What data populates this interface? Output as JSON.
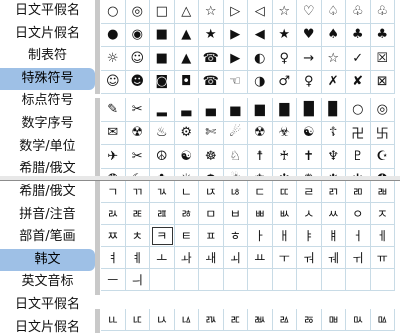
{
  "top_panel": {
    "sidebar": [
      {
        "label": "日文平假名",
        "active": false
      },
      {
        "label": "日文片假名",
        "active": false
      },
      {
        "label": "制表符",
        "active": false
      },
      {
        "label": "特殊符号",
        "active": true
      },
      {
        "label": "标点符号",
        "active": false
      },
      {
        "label": "数字序号",
        "active": false
      },
      {
        "label": "数学/单位",
        "active": false
      },
      {
        "label": "希腊/俄文",
        "active": false
      }
    ],
    "block1": [
      [
        "○",
        "◎",
        "□",
        "△",
        "☆",
        "▷",
        "◁",
        "☆",
        "♡",
        "♤",
        "♧",
        "♧"
      ],
      [
        "●",
        "◉",
        "■",
        "▲",
        "★",
        "▶",
        "◀",
        "★",
        "♥",
        "♠",
        "♣",
        "♣"
      ],
      [
        "☼",
        "☺",
        "■",
        "▲",
        "☎",
        "▶",
        "◐",
        "♀",
        "→",
        "☆",
        "✓",
        "☒"
      ],
      [
        "☺",
        "☻",
        "◙",
        "◘",
        "☎",
        "☜",
        "◑",
        "♂",
        "♀",
        "✗",
        "✘",
        "⊠"
      ]
    ],
    "block2": [
      [
        "✎",
        "✂",
        "▂",
        "▃",
        "▄",
        "▅",
        "▆",
        "▇",
        "█",
        "▉",
        "○",
        "◎"
      ],
      [
        "✉",
        "☢",
        "♨",
        "⚙",
        "✄",
        "☄",
        "☢",
        "☣",
        "☯",
        "☦",
        "卍",
        "卐"
      ],
      [
        "✈",
        "✂",
        "☮",
        "☯",
        "☸",
        "♘",
        "☨",
        "♰",
        "✝",
        "♆",
        "♇",
        "☪"
      ],
      [
        "❂",
        "☾",
        "✿",
        "☀",
        "☂",
        "☃",
        "❄",
        "✼",
        "✺",
        "❉",
        "✲",
        "✪"
      ]
    ]
  },
  "bottom_panel": {
    "sidebar": [
      {
        "label": "希腊/俄文",
        "active": false
      },
      {
        "label": "拼音/注音",
        "active": false
      },
      {
        "label": "部首/笔画",
        "active": false
      },
      {
        "label": "韩文",
        "active": true
      },
      {
        "label": "英文音标",
        "active": false
      },
      {
        "label": "日文平假名",
        "active": false
      },
      {
        "label": "日文片假名",
        "active": false
      }
    ],
    "block1": [
      [
        "ㄱ",
        "ㄲ",
        "ㄳ",
        "ㄴ",
        "ㄵ",
        "ㄶ",
        "ㄷ",
        "ㄸ",
        "ㄹ",
        "ㄺ",
        "ㄻ",
        "ㄼ"
      ],
      [
        "ㄽ",
        "ㄾ",
        "ㄿ",
        "ㅀ",
        "ㅁ",
        "ㅂ",
        "ㅃ",
        "ㅄ",
        "ㅅ",
        "ㅆ",
        "ㅇ",
        "ㅈ"
      ],
      [
        "ㅉ",
        "ㅊ",
        "ㅋ",
        "ㅌ",
        "ㅍ",
        "ㅎ",
        "ㅏ",
        "ㅐ",
        "ㅑ",
        "ㅒ",
        "ㅓ",
        "ㅔ"
      ],
      [
        "ㅕ",
        "ㅖ",
        "ㅗ",
        "ㅘ",
        "ㅙ",
        "ㅚ",
        "ㅛ",
        "ㅜ",
        "ㅝ",
        "ㅞ",
        "ㅟ",
        "ㅠ"
      ],
      [
        "ㅡ",
        "ㅢ",
        "",
        "",
        "",
        "",
        "",
        "",
        "",
        "",
        "",
        ""
      ]
    ],
    "block2": [
      [
        "ㅥ",
        "ㅦ",
        "ㅧ",
        "ㅨ",
        "ㅩ",
        "ㅪ",
        "ㅫ",
        "ㅬ",
        "ㅭ",
        "ㅮ",
        "ㅯ",
        "ㅰ"
      ]
    ],
    "selected_cell": "ㅋ"
  }
}
